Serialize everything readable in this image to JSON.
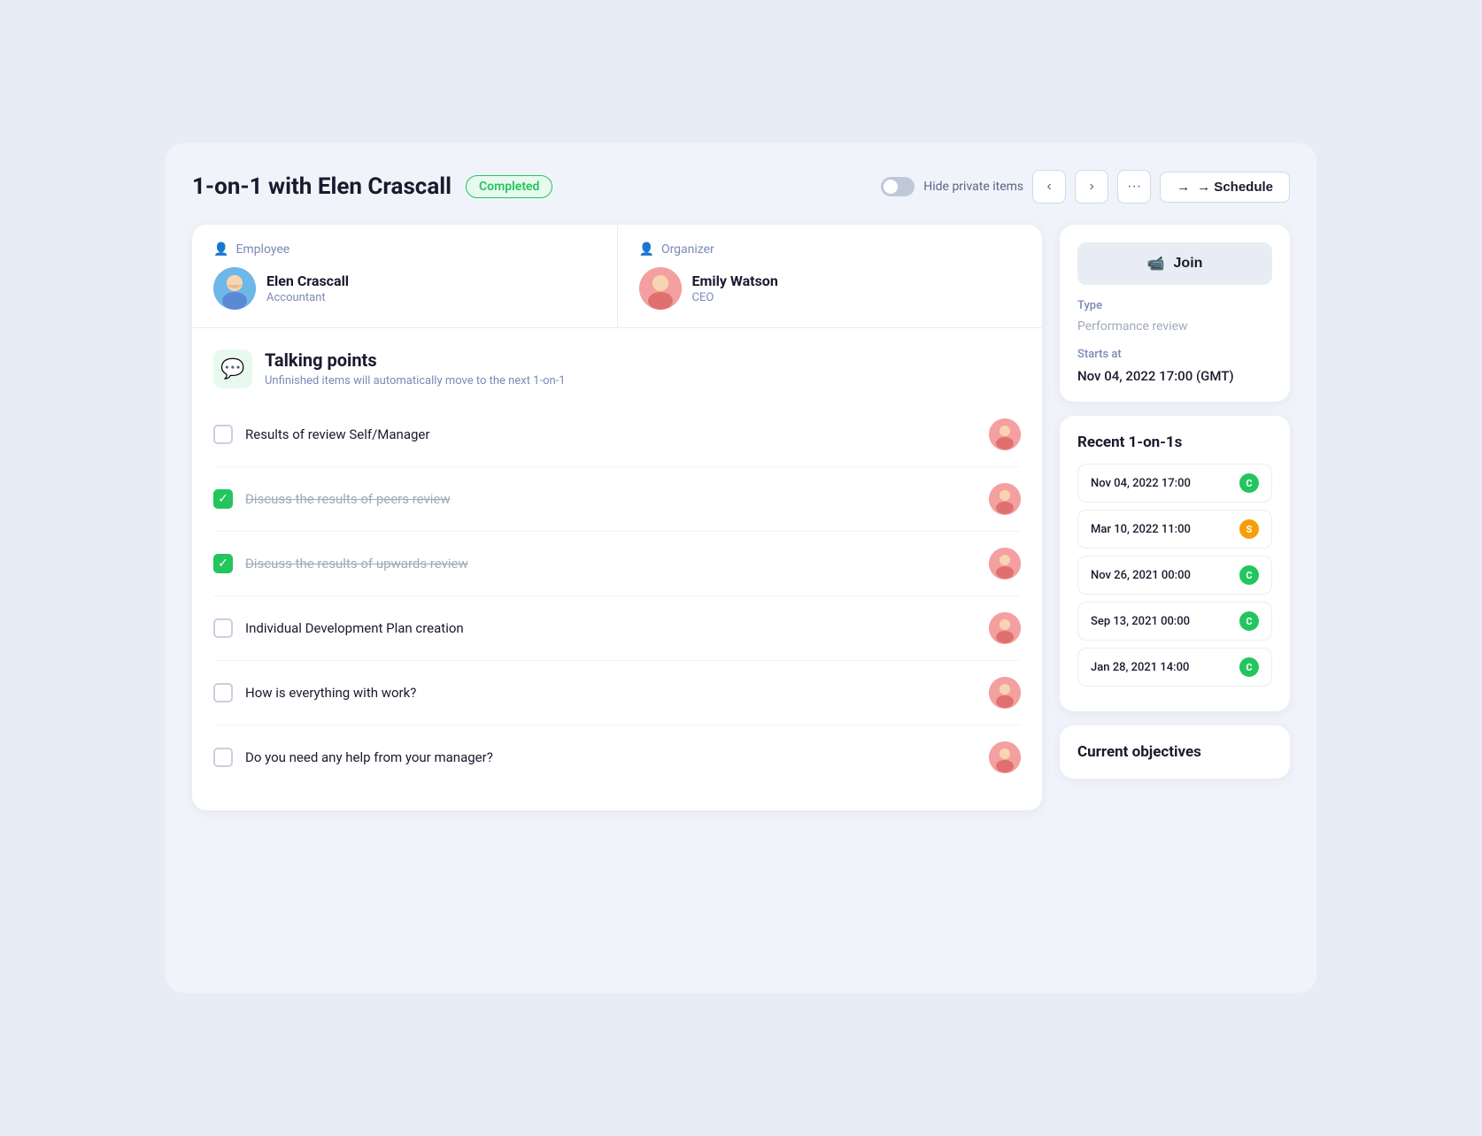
{
  "header": {
    "title": "1-on-1 with Elen Crascall",
    "status": "Completed",
    "toggle_label": "Hide private items",
    "schedule_label": "→ Schedule"
  },
  "employee": {
    "role": "Employee",
    "name": "Elen Crascall",
    "title": "Accountant"
  },
  "organizer": {
    "role": "Organizer",
    "name": "Emily Watson",
    "title": "CEO"
  },
  "talking_points": {
    "title": "Talking points",
    "subtitle": "Unfinished items will automatically move to the next 1-on-1"
  },
  "agenda_items": [
    {
      "id": 1,
      "text": "Results of review Self/Manager",
      "checked": false,
      "strikethrough": false
    },
    {
      "id": 2,
      "text": "Discuss the results of peers review",
      "checked": true,
      "strikethrough": true
    },
    {
      "id": 3,
      "text": "Discuss the results of upwards review",
      "checked": true,
      "strikethrough": true
    },
    {
      "id": 4,
      "text": "Individual Development Plan creation",
      "checked": false,
      "strikethrough": false
    },
    {
      "id": 5,
      "text": "How is everything with work?",
      "checked": false,
      "strikethrough": false
    },
    {
      "id": 6,
      "text": "Do you need any help from your manager?",
      "checked": false,
      "strikethrough": false
    }
  ],
  "right_panel": {
    "join_label": "Join",
    "type_label": "Type",
    "type_value": "Performance review",
    "starts_label": "Starts at",
    "starts_value": "Nov 04, 2022 17:00 (GMT)",
    "recent_label": "Recent 1-on-1s",
    "recent_items": [
      {
        "date": "Nov 04, 2022 17:00",
        "badge_color": "green"
      },
      {
        "date": "Mar 10, 2022 11:00",
        "badge_color": "yellow"
      },
      {
        "date": "Nov 26, 2021 00:00",
        "badge_color": "green"
      },
      {
        "date": "Sep 13, 2021 00:00",
        "badge_color": "green"
      },
      {
        "date": "Jan 28, 2021 14:00",
        "badge_color": "green"
      }
    ],
    "objectives_label": "Current objectives"
  }
}
